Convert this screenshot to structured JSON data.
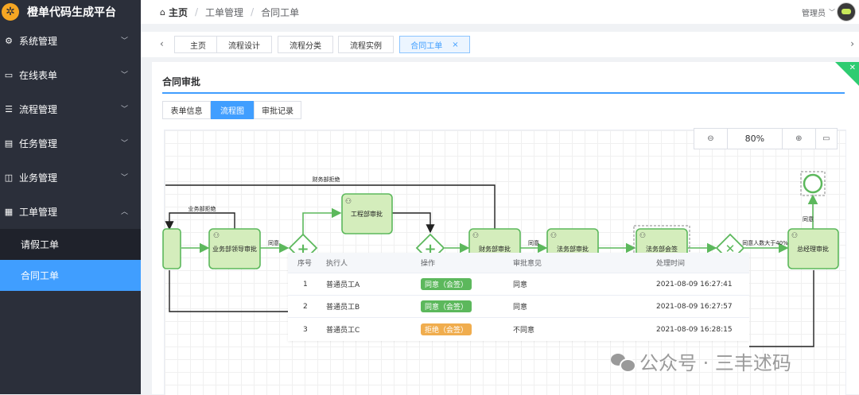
{
  "brand": {
    "title": "橙单代码生成平台"
  },
  "sidebar": {
    "items": [
      {
        "label": "系统管理",
        "icon": "gear-icon"
      },
      {
        "label": "在线表单",
        "icon": "form-icon"
      },
      {
        "label": "流程管理",
        "icon": "sliders-icon"
      },
      {
        "label": "任务管理",
        "icon": "document-icon"
      },
      {
        "label": "业务管理",
        "icon": "bag-icon"
      },
      {
        "label": "工单管理",
        "icon": "grid-icon"
      }
    ],
    "subitems": [
      {
        "label": "请假工单"
      },
      {
        "label": "合同工单"
      }
    ]
  },
  "header": {
    "breadcrumb": [
      "主页",
      "工单管理",
      "合同工单"
    ],
    "user": "管理员"
  },
  "tabs": [
    "主页",
    "流程设计",
    "流程分类",
    "流程实例",
    "合同工单"
  ],
  "card": {
    "title": "合同审批"
  },
  "subtabs": [
    "表单信息",
    "流程图",
    "审批记录"
  ],
  "zoom": {
    "level": "80%"
  },
  "flow": {
    "nodes": {
      "biz": "业务部领导审批",
      "eng": "工程部审批",
      "fin": "财务部审批",
      "law": "法务部审批",
      "lawsign": "法务部会签",
      "gm": "总经理审批"
    },
    "labels": {
      "fin_reject": "财务部拒绝",
      "biz_reject": "业务部拒绝",
      "agree1": "同意",
      "agree2": "同意",
      "agree3": "同意",
      "agree_pct": "同意人数大于40%"
    }
  },
  "table": {
    "headers": [
      "序号",
      "执行人",
      "操作",
      "审批意见",
      "处理时间"
    ],
    "rows": [
      {
        "no": "1",
        "user": "普通员工A",
        "action": "同意（会签）",
        "opinion": "同意",
        "time": "2021-08-09 16:27:41",
        "tag": "green"
      },
      {
        "no": "2",
        "user": "普通员工B",
        "action": "同意（会签）",
        "opinion": "同意",
        "time": "2021-08-09 16:27:57",
        "tag": "green"
      },
      {
        "no": "3",
        "user": "普通员工C",
        "action": "拒绝（会签）",
        "opinion": "不同意",
        "time": "2021-08-09 16:28:15",
        "tag": "orange"
      }
    ]
  },
  "watermark": {
    "text": "公众号 · 三丰述码"
  },
  "colors": {
    "accent": "#409eff",
    "flow_green": "#5cb85c",
    "sidebar": "#2b2f3a",
    "reject": "#f0ad4e"
  }
}
